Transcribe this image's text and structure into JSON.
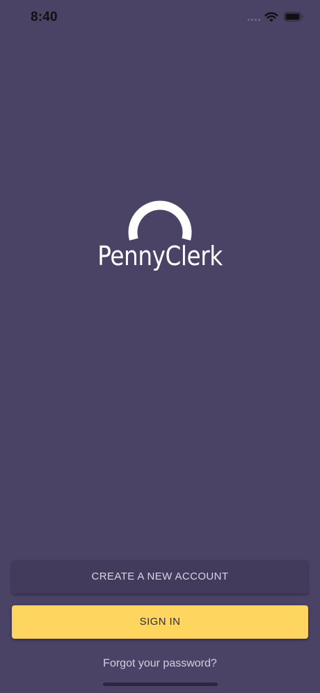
{
  "status_bar": {
    "time": "8:40"
  },
  "logo": {
    "wordmark": "PennyClerk",
    "icon": "pennyclerk-arc-logo"
  },
  "actions": {
    "create_account_label": "CREATE A NEW ACCOUNT",
    "sign_in_label": "SIGN IN",
    "forgot_password_label": "Forgot your password?"
  },
  "colors": {
    "background": "#4a4366",
    "create_button": "#433b5c",
    "sign_in_button": "#fed55f",
    "link_text": "#d4cfe3"
  },
  "icons": {
    "signal": "signal-dots-icon",
    "wifi": "wifi-icon",
    "battery": "battery-icon"
  }
}
